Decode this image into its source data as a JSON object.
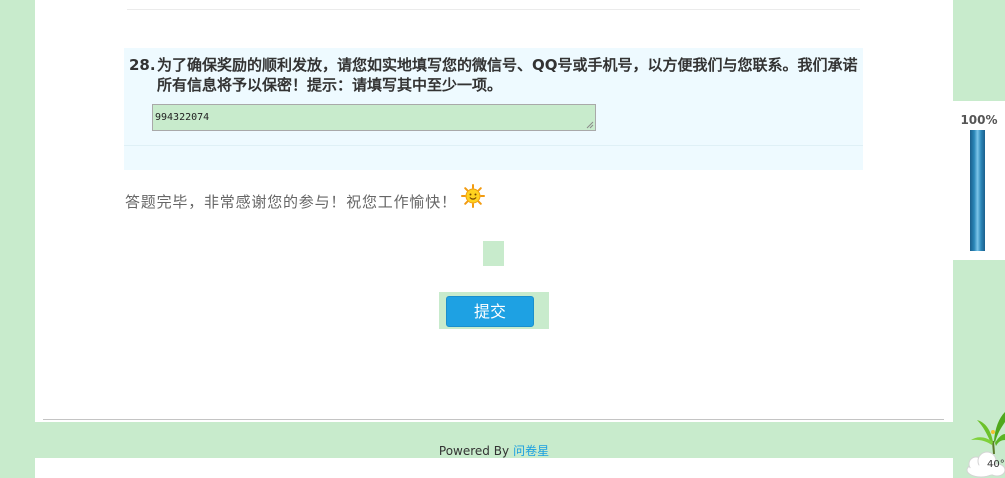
{
  "survey": {
    "question": {
      "number": "28.",
      "text": "为了确保奖励的顺利发放，请您如实地填写您的微信号、QQ号或手机号，以方便我们与您联系。我们承诺所有信息将予以保密！提示：请填写其中至少一项。",
      "answer_value": "994322074"
    },
    "completion_message": "答题完毕，非常感谢您的参与！祝您工作愉快！",
    "completion_icon": "sun-smiley-icon",
    "submit_label": "提交"
  },
  "footer": {
    "powered_by": "Powered By",
    "brand_link": "问卷星"
  },
  "progress": {
    "label": "100%",
    "value": 1.0
  },
  "weather_widget": {
    "temperature": "40°",
    "icons": [
      "plant-icon",
      "cloud-icon"
    ]
  },
  "colors": {
    "page_background": "#c8ebcc",
    "question_background": "#eefaff",
    "input_background": "#c8ebcc",
    "submit_button": "#1ea1e3",
    "link": "#1a9fe0",
    "progress_bar": "#2b86b8"
  }
}
